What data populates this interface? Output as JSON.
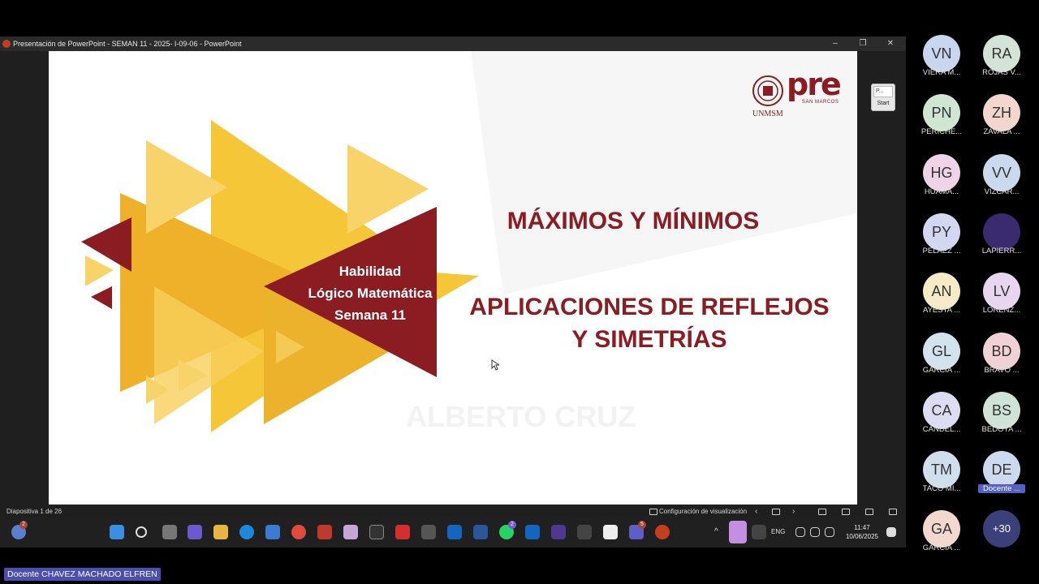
{
  "window": {
    "title": "Presentación de PowerPoint  -  SEMAN 11 - 2025- I-09-06 - PowerPoint",
    "minimize": "–",
    "restore": "❐",
    "close": "✕"
  },
  "slide": {
    "logo_text": "pre",
    "logo_sub": "SAN MARCOS",
    "logo_inst": "UNMSM",
    "habilidad_lines": [
      "Habilidad",
      "Lógico Matemática",
      "Semana 11"
    ],
    "title1": "MÁXIMOS Y MÍNIMOS",
    "title2": "APLICACIONES DE REFLEJOS Y SIMETRÍAS",
    "watermark": "ALBERTO CRUZ",
    "accent_color": "#8b1c22",
    "triangle_color": "#f2b824"
  },
  "start_button": {
    "thumb": "P...",
    "label": "Start"
  },
  "statusbar": {
    "slide_info": "Diapositiva 1 de 26",
    "view_config": "Configuración de visualización"
  },
  "taskbar": {
    "weather_badge": "2",
    "xd_label": "XD\npen",
    "whatsapp_badge": "2",
    "teams_badge": "5",
    "lang": "ENG",
    "time": "11:47",
    "date": "10/06/2025"
  },
  "participants": [
    {
      "initials": "VN",
      "name": "VIERA M...",
      "color": "#c9d6ef"
    },
    {
      "initials": "RA",
      "name": "ROJAS V...",
      "color": "#d3e4d6"
    },
    {
      "initials": "PN",
      "name": "PERICHE...",
      "color": "#cfe6d3"
    },
    {
      "initials": "ZH",
      "name": "ZAVALA ...",
      "color": "#f3d6cc"
    },
    {
      "initials": "HG",
      "name": "HUAMA...",
      "color": "#eed4e6"
    },
    {
      "initials": "VV",
      "name": "VIZCAR...",
      "color": "#cbd9ef"
    },
    {
      "initials": "PY",
      "name": "PELAEZ ...",
      "color": "#d2d7f2"
    },
    {
      "initials": "",
      "name": "LAPIERR...",
      "color": "#3a2a6e"
    },
    {
      "initials": "AN",
      "name": "AYESTA ...",
      "color": "#f6ebc6"
    },
    {
      "initials": "LV",
      "name": "LORENZ...",
      "color": "#e8d6ee"
    },
    {
      "initials": "GL",
      "name": "GARCIA ...",
      "color": "#d3e3ee"
    },
    {
      "initials": "BD",
      "name": "BRAVO ...",
      "color": "#f0d1d6"
    },
    {
      "initials": "CA",
      "name": "CANDEL...",
      "color": "#dcdcf3"
    },
    {
      "initials": "BS",
      "name": "BEDOYA ...",
      "color": "#cfe3d9"
    },
    {
      "initials": "TM",
      "name": "TACO MI...",
      "color": "#cfe0ec"
    },
    {
      "initials": "DE",
      "name": "Docente ...",
      "color": "#cdd9ee"
    },
    {
      "initials": "GA",
      "name": "GARCIA ...",
      "color": "#f3d8cf"
    },
    {
      "initials": "+30",
      "name": "",
      "color": "#3b3f7a"
    }
  ],
  "presenter_label": "Docente CHAVEZ MACHADO ELFREN"
}
